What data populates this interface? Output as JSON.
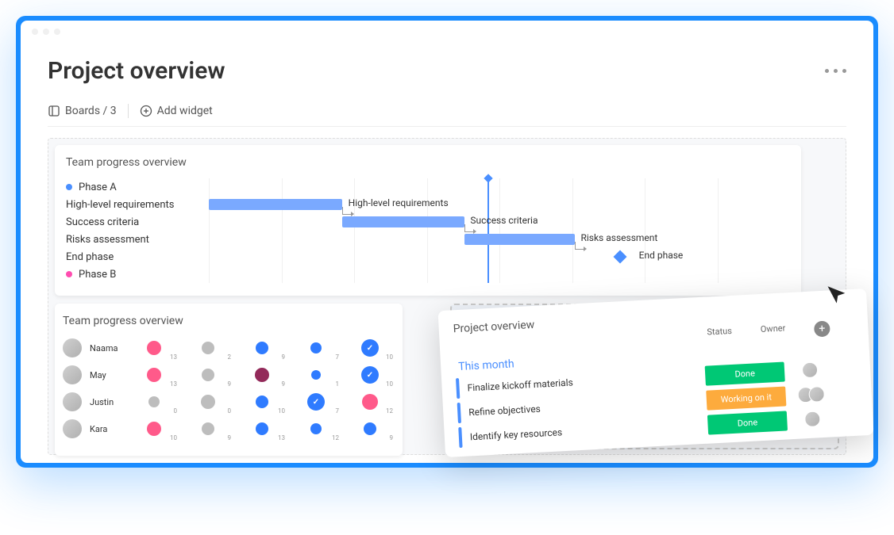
{
  "page": {
    "title": "Project overview"
  },
  "toolbar": {
    "boards_label": "Boards / 3",
    "add_widget_label": "Add widget"
  },
  "gantt": {
    "title": "Team progress overview",
    "phases": [
      {
        "name": "Phase A",
        "color": "#4a8fff"
      },
      {
        "name": "Phase B",
        "color": "#ff4db0"
      }
    ],
    "rows": [
      {
        "label": "High-level requirements",
        "bar_label": "High-level requirements"
      },
      {
        "label": "Success criteria",
        "bar_label": "Success criteria"
      },
      {
        "label": "Risks assessment",
        "bar_label": "Risks assessment"
      },
      {
        "label": "End phase",
        "bar_label": "End phase"
      }
    ]
  },
  "progress": {
    "title": "Team progress overview",
    "members": [
      {
        "name": "Naama",
        "cells": [
          {
            "color": "#ff5a8a",
            "size": 18,
            "count": 13
          },
          {
            "color": "#bdbdbd",
            "size": 16,
            "count": 2
          },
          {
            "color": "#2f7bff",
            "size": 16,
            "count": 9
          },
          {
            "color": "#2f7bff",
            "size": 14,
            "count": 7
          },
          {
            "color": "#2f7bff",
            "size": 22,
            "count": 10,
            "check": true
          }
        ]
      },
      {
        "name": "May",
        "cells": [
          {
            "color": "#ff5a8a",
            "size": 18,
            "count": 13
          },
          {
            "color": "#bdbdbd",
            "size": 16,
            "count": 9
          },
          {
            "color": "#932a5a",
            "size": 18,
            "count": 9
          },
          {
            "color": "#2f7bff",
            "size": 12,
            "count": 1
          },
          {
            "color": "#2f7bff",
            "size": 22,
            "count": 10,
            "check": true
          }
        ]
      },
      {
        "name": "Justin",
        "cells": [
          {
            "color": "#bdbdbd",
            "size": 14,
            "count": 0
          },
          {
            "color": "#bdbdbd",
            "size": 18,
            "count": 0
          },
          {
            "color": "#2f7bff",
            "size": 16,
            "count": 10
          },
          {
            "color": "#2f7bff",
            "size": 22,
            "count": 7,
            "check": true
          },
          {
            "color": "#ff5a8a",
            "size": 20,
            "count": 12
          }
        ]
      },
      {
        "name": "Kara",
        "cells": [
          {
            "color": "#ff5a8a",
            "size": 18,
            "count": 10
          },
          {
            "color": "#bdbdbd",
            "size": 16,
            "count": 9
          },
          {
            "color": "#2f7bff",
            "size": 16,
            "count": 13
          },
          {
            "color": "#2f7bff",
            "size": 14,
            "count": 12
          },
          {
            "color": "#2f7bff",
            "size": 16,
            "count": 9
          }
        ]
      }
    ]
  },
  "overview_card": {
    "title": "Project overview",
    "col_status": "Status",
    "col_owner": "Owner",
    "group": "This month",
    "rows": [
      {
        "task": "Finalize kickoff materials",
        "status": "Done",
        "status_color": "#00c875",
        "owners": 1
      },
      {
        "task": "Refine objectives",
        "status": "Working on it",
        "status_color": "#fdab3d",
        "owners": 2
      },
      {
        "task": "Identify key resources",
        "status": "Done",
        "status_color": "#00c875",
        "owners": 1
      }
    ]
  },
  "chart_data": {
    "type": "gantt",
    "title": "Team progress overview",
    "today_position_pct": 48,
    "tasks": [
      {
        "name": "High-level requirements",
        "start_pct": 0,
        "end_pct": 23
      },
      {
        "name": "Success criteria",
        "start_pct": 23,
        "end_pct": 44
      },
      {
        "name": "Risks assessment",
        "start_pct": 44,
        "end_pct": 63
      },
      {
        "name": "End phase",
        "start_pct": 70,
        "end_pct": 70,
        "milestone": true
      }
    ]
  }
}
